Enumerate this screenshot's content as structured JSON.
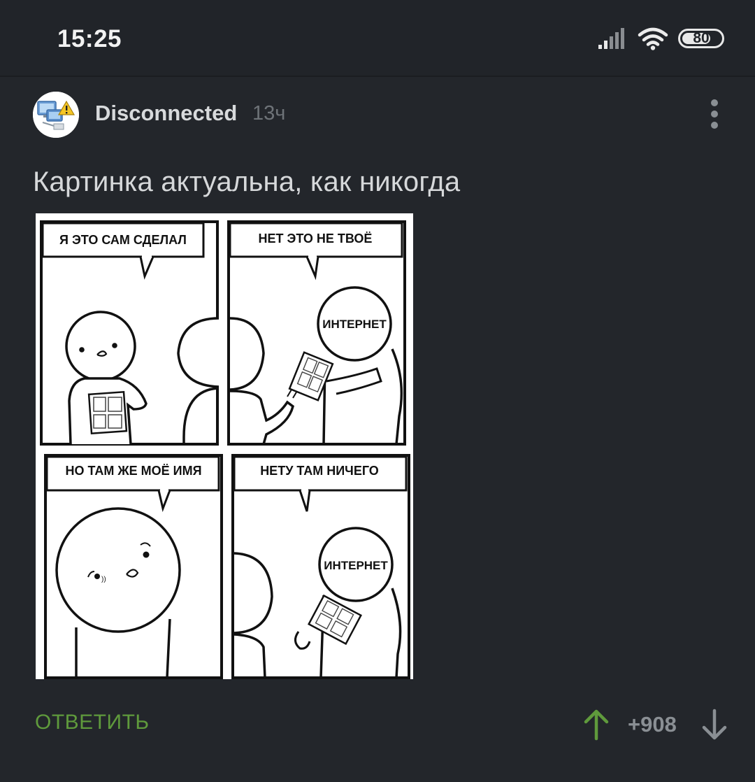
{
  "status_bar": {
    "time": "15:25",
    "battery_level": "80",
    "icons": [
      "signal-icon",
      "wifi-icon",
      "battery-icon"
    ]
  },
  "post": {
    "author": "Disconnected",
    "time_ago": "13ч",
    "text": "Картинка актуальна, как никогда",
    "comic": {
      "panels": [
        {
          "caption": "Я ЭТО САМ СДЕЛАЛ"
        },
        {
          "caption": "НЕТ ЭТО НЕ ТВОЁ",
          "head_label": "ИНТЕРНЕТ"
        },
        {
          "caption": "НО ТАМ ЖЕ МОЁ ИМЯ"
        },
        {
          "caption": "НЕТУ ТАМ НИЧЕГО",
          "head_label": "ИНТЕРНЕТ"
        }
      ]
    }
  },
  "actions": {
    "reply_label": "ОТВЕТИТЬ",
    "score": "+908",
    "upvote_color": "#5f9a3c",
    "downvote_color": "#8a8f94"
  },
  "colors": {
    "background": "#23262b",
    "accent_green": "#5f9a3c"
  }
}
